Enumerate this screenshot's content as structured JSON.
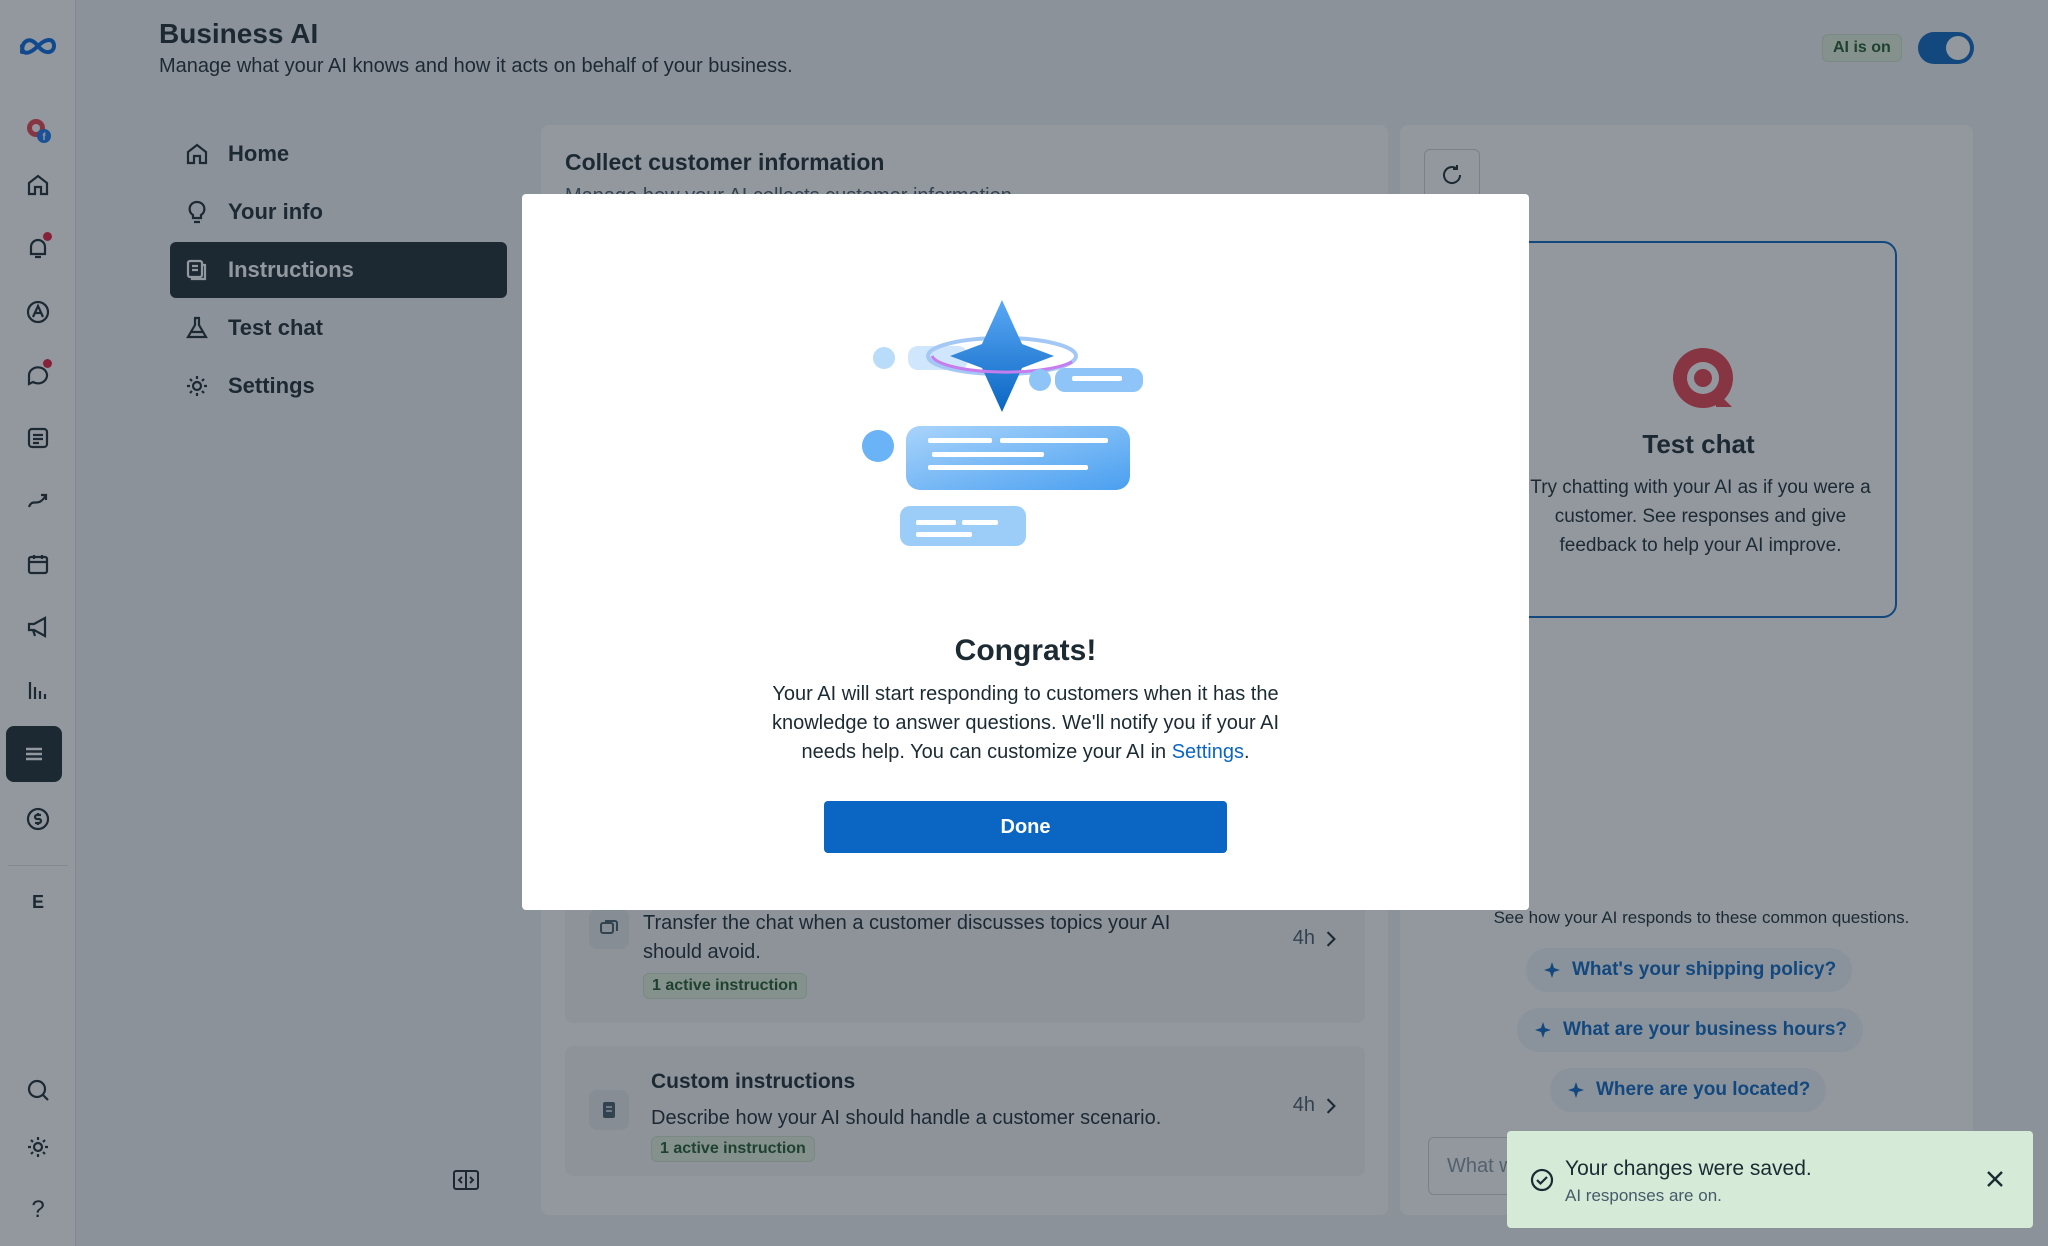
{
  "header": {
    "title": "Business AI",
    "subtitle": "Manage what your AI knows and how it acts on behalf of your business.",
    "ai_status_badge": "AI is on"
  },
  "rail": {
    "letter": "E",
    "help_label": "?"
  },
  "subnav": {
    "items": [
      {
        "label": "Home",
        "icon": "home-icon"
      },
      {
        "label": "Your info",
        "icon": "lightbulb-icon"
      },
      {
        "label": "Instructions",
        "icon": "instructions-icon"
      },
      {
        "label": "Test chat",
        "icon": "flask-icon"
      },
      {
        "label": "Settings",
        "icon": "gear-icon"
      }
    ],
    "active_index": 2
  },
  "main": {
    "title": "Collect customer information",
    "subtitle_partial": "Manage how your AI collects customer information.",
    "rows": [
      {
        "description": "Transfer the chat when a customer discusses topics your AI should avoid.",
        "badge": "1 active instruction",
        "time": "4h"
      },
      {
        "title": "Custom instructions",
        "description": "Describe how your AI should handle a customer scenario.",
        "badge": "1 active instruction",
        "time": "4h"
      }
    ]
  },
  "test_panel": {
    "card_title": "Test chat",
    "card_description": "Try chatting with your AI as if you were a customer. See responses and give feedback to help your AI improve.",
    "questions_hint": "See how your AI responds to these common questions.",
    "suggestions": [
      "What's your shipping policy?",
      "What are your business hours?",
      "Where are you located?"
    ],
    "input_placeholder": "What would you like to ask?"
  },
  "modal": {
    "title": "Congrats!",
    "body_prefix": "Your AI will start responding to customers when it has the knowledge to answer questions. We'll notify you if your AI needs help. You can customize your AI in ",
    "body_link": "Settings",
    "body_suffix": ".",
    "done_label": "Done"
  },
  "toast": {
    "title": "Your changes were saved.",
    "subtitle": "AI responses are on."
  },
  "colors": {
    "accent": "#0a66c2",
    "nav_active": "#1c2b33",
    "success_bg": "#d5ebd7",
    "badge_bg": "#e3f1df",
    "notification": "#e41e3f"
  }
}
